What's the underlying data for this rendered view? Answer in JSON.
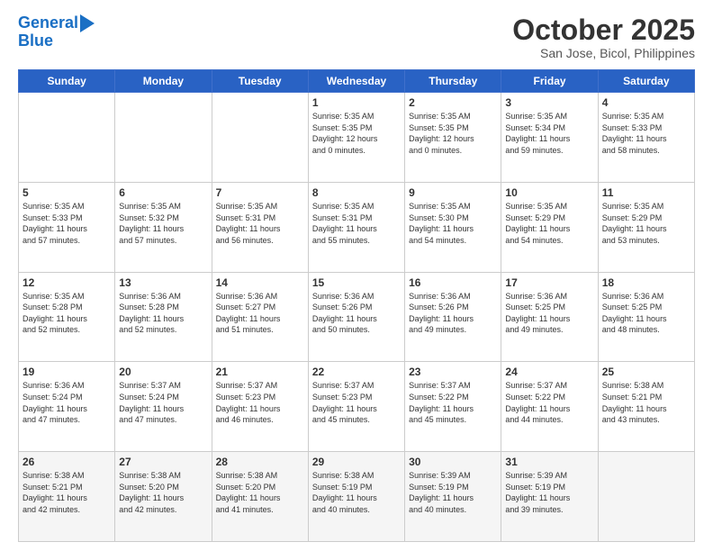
{
  "logo": {
    "line1": "General",
    "line2": "Blue"
  },
  "title": "October 2025",
  "subtitle": "San Jose, Bicol, Philippines",
  "days_header": [
    "Sunday",
    "Monday",
    "Tuesday",
    "Wednesday",
    "Thursday",
    "Friday",
    "Saturday"
  ],
  "weeks": [
    [
      {
        "day": "",
        "info": ""
      },
      {
        "day": "",
        "info": ""
      },
      {
        "day": "",
        "info": ""
      },
      {
        "day": "1",
        "info": "Sunrise: 5:35 AM\nSunset: 5:35 PM\nDaylight: 12 hours\nand 0 minutes."
      },
      {
        "day": "2",
        "info": "Sunrise: 5:35 AM\nSunset: 5:35 PM\nDaylight: 12 hours\nand 0 minutes."
      },
      {
        "day": "3",
        "info": "Sunrise: 5:35 AM\nSunset: 5:34 PM\nDaylight: 11 hours\nand 59 minutes."
      },
      {
        "day": "4",
        "info": "Sunrise: 5:35 AM\nSunset: 5:33 PM\nDaylight: 11 hours\nand 58 minutes."
      }
    ],
    [
      {
        "day": "5",
        "info": "Sunrise: 5:35 AM\nSunset: 5:33 PM\nDaylight: 11 hours\nand 57 minutes."
      },
      {
        "day": "6",
        "info": "Sunrise: 5:35 AM\nSunset: 5:32 PM\nDaylight: 11 hours\nand 57 minutes."
      },
      {
        "day": "7",
        "info": "Sunrise: 5:35 AM\nSunset: 5:31 PM\nDaylight: 11 hours\nand 56 minutes."
      },
      {
        "day": "8",
        "info": "Sunrise: 5:35 AM\nSunset: 5:31 PM\nDaylight: 11 hours\nand 55 minutes."
      },
      {
        "day": "9",
        "info": "Sunrise: 5:35 AM\nSunset: 5:30 PM\nDaylight: 11 hours\nand 54 minutes."
      },
      {
        "day": "10",
        "info": "Sunrise: 5:35 AM\nSunset: 5:29 PM\nDaylight: 11 hours\nand 54 minutes."
      },
      {
        "day": "11",
        "info": "Sunrise: 5:35 AM\nSunset: 5:29 PM\nDaylight: 11 hours\nand 53 minutes."
      }
    ],
    [
      {
        "day": "12",
        "info": "Sunrise: 5:35 AM\nSunset: 5:28 PM\nDaylight: 11 hours\nand 52 minutes."
      },
      {
        "day": "13",
        "info": "Sunrise: 5:36 AM\nSunset: 5:28 PM\nDaylight: 11 hours\nand 52 minutes."
      },
      {
        "day": "14",
        "info": "Sunrise: 5:36 AM\nSunset: 5:27 PM\nDaylight: 11 hours\nand 51 minutes."
      },
      {
        "day": "15",
        "info": "Sunrise: 5:36 AM\nSunset: 5:26 PM\nDaylight: 11 hours\nand 50 minutes."
      },
      {
        "day": "16",
        "info": "Sunrise: 5:36 AM\nSunset: 5:26 PM\nDaylight: 11 hours\nand 49 minutes."
      },
      {
        "day": "17",
        "info": "Sunrise: 5:36 AM\nSunset: 5:25 PM\nDaylight: 11 hours\nand 49 minutes."
      },
      {
        "day": "18",
        "info": "Sunrise: 5:36 AM\nSunset: 5:25 PM\nDaylight: 11 hours\nand 48 minutes."
      }
    ],
    [
      {
        "day": "19",
        "info": "Sunrise: 5:36 AM\nSunset: 5:24 PM\nDaylight: 11 hours\nand 47 minutes."
      },
      {
        "day": "20",
        "info": "Sunrise: 5:37 AM\nSunset: 5:24 PM\nDaylight: 11 hours\nand 47 minutes."
      },
      {
        "day": "21",
        "info": "Sunrise: 5:37 AM\nSunset: 5:23 PM\nDaylight: 11 hours\nand 46 minutes."
      },
      {
        "day": "22",
        "info": "Sunrise: 5:37 AM\nSunset: 5:23 PM\nDaylight: 11 hours\nand 45 minutes."
      },
      {
        "day": "23",
        "info": "Sunrise: 5:37 AM\nSunset: 5:22 PM\nDaylight: 11 hours\nand 45 minutes."
      },
      {
        "day": "24",
        "info": "Sunrise: 5:37 AM\nSunset: 5:22 PM\nDaylight: 11 hours\nand 44 minutes."
      },
      {
        "day": "25",
        "info": "Sunrise: 5:38 AM\nSunset: 5:21 PM\nDaylight: 11 hours\nand 43 minutes."
      }
    ],
    [
      {
        "day": "26",
        "info": "Sunrise: 5:38 AM\nSunset: 5:21 PM\nDaylight: 11 hours\nand 42 minutes."
      },
      {
        "day": "27",
        "info": "Sunrise: 5:38 AM\nSunset: 5:20 PM\nDaylight: 11 hours\nand 42 minutes."
      },
      {
        "day": "28",
        "info": "Sunrise: 5:38 AM\nSunset: 5:20 PM\nDaylight: 11 hours\nand 41 minutes."
      },
      {
        "day": "29",
        "info": "Sunrise: 5:38 AM\nSunset: 5:19 PM\nDaylight: 11 hours\nand 40 minutes."
      },
      {
        "day": "30",
        "info": "Sunrise: 5:39 AM\nSunset: 5:19 PM\nDaylight: 11 hours\nand 40 minutes."
      },
      {
        "day": "31",
        "info": "Sunrise: 5:39 AM\nSunset: 5:19 PM\nDaylight: 11 hours\nand 39 minutes."
      },
      {
        "day": "",
        "info": ""
      }
    ]
  ]
}
